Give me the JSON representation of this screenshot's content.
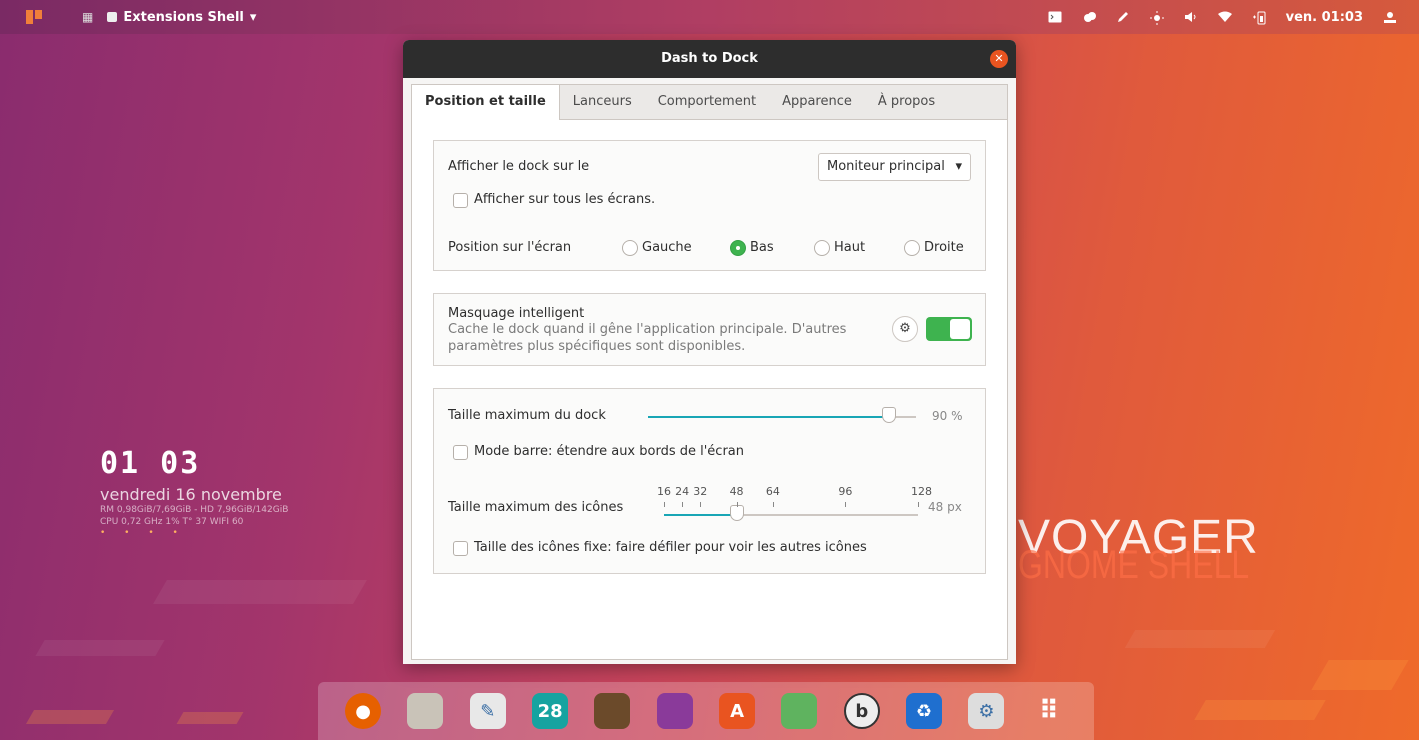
{
  "topbar": {
    "app_name": "Extensions Shell",
    "app_menu_arrow": "▾",
    "grid_glyph": "▦",
    "clock": "ven. 01:03",
    "tray_icons": [
      "terminal-icon",
      "weather-icon",
      "pen-icon",
      "brightness-icon",
      "volume-icon",
      "wifi-icon",
      "battery-icon",
      "user-icon"
    ]
  },
  "desktop": {
    "clock_time": "01 03",
    "clock_date": "vendredi 16 novembre",
    "stats_line1": "RM 0,98GiB/7,69GiB - HD 7,96GiB/142GiB",
    "stats_line2": "CPU 0,72 GHz 1% T° 37  WIFI 60",
    "dots": "• • • •",
    "brand_1": "VOYAGER",
    "brand_2": "GNOME SHELL"
  },
  "window": {
    "title": "Dash to Dock",
    "close_glyph": "✕",
    "tabs": [
      {
        "label": "Position et taille",
        "active": true
      },
      {
        "label": "Lanceurs",
        "active": false
      },
      {
        "label": "Comportement",
        "active": false
      },
      {
        "label": "Apparence",
        "active": false
      },
      {
        "label": "À propos",
        "active": false
      }
    ]
  },
  "position_frame": {
    "show_dock_label": "Afficher le dock sur le",
    "monitor_combo": "Moniteur principal",
    "combo_arrow": "▾",
    "all_screens_label": "Afficher sur tous les écrans.",
    "all_screens_checked": false,
    "position_label": "Position sur l'écran",
    "positions": [
      {
        "label": "Gauche",
        "selected": false
      },
      {
        "label": "Bas",
        "selected": true
      },
      {
        "label": "Haut",
        "selected": false
      },
      {
        "label": "Droite",
        "selected": false
      }
    ]
  },
  "intellihide_frame": {
    "title": "Masquage intelligent",
    "description_line1": "Cache le dock quand il gêne l'application principale. D'autres",
    "description_line2": "paramètres plus spécifiques sont disponibles.",
    "settings_glyph": "⚙",
    "enabled": true
  },
  "size_frame": {
    "max_dock_label": "Taille maximum du dock",
    "max_dock_value": "90 %",
    "max_dock_fraction": 0.9,
    "panel_mode_label": "Mode barre: étendre aux bords de l'écran",
    "panel_mode_checked": false,
    "icon_size_label": "Taille maximum des icônes",
    "icon_size_marks": [
      "16",
      "24",
      "32",
      "48",
      "64",
      "96",
      "128"
    ],
    "icon_size_value": "48 px",
    "icon_size_current": 48,
    "fixed_size_label": "Taille des icônes fixe: faire défiler pour voir les autres icônes",
    "fixed_size_checked": false
  },
  "dock": {
    "items": [
      {
        "name": "firefox-icon",
        "color": "#e66000",
        "glyph": "●"
      },
      {
        "name": "files-icon",
        "color": "#c9c3b8",
        "glyph": ""
      },
      {
        "name": "text-editor-icon",
        "color": "#e8e8e8",
        "glyph": "✎"
      },
      {
        "name": "calendar-icon",
        "color": "#16a3a0",
        "glyph": "28"
      },
      {
        "name": "tv-icon",
        "color": "#6b4a2a",
        "glyph": ""
      },
      {
        "name": "video-icon",
        "color": "#8a3a9a",
        "glyph": ""
      },
      {
        "name": "software-center-icon",
        "color": "#e95420",
        "glyph": "A"
      },
      {
        "name": "tweaks-icon",
        "color": "#5fb35f",
        "glyph": ""
      },
      {
        "name": "budgie-icon",
        "color": "#eeeeee",
        "glyph": "b"
      },
      {
        "name": "trash-icon",
        "color": "#1f6fcf",
        "glyph": "♻"
      },
      {
        "name": "settings-icon",
        "color": "#dddddd",
        "glyph": "⚙"
      },
      {
        "name": "app-grid-icon",
        "color": "transparent",
        "glyph": "⠿"
      }
    ]
  }
}
